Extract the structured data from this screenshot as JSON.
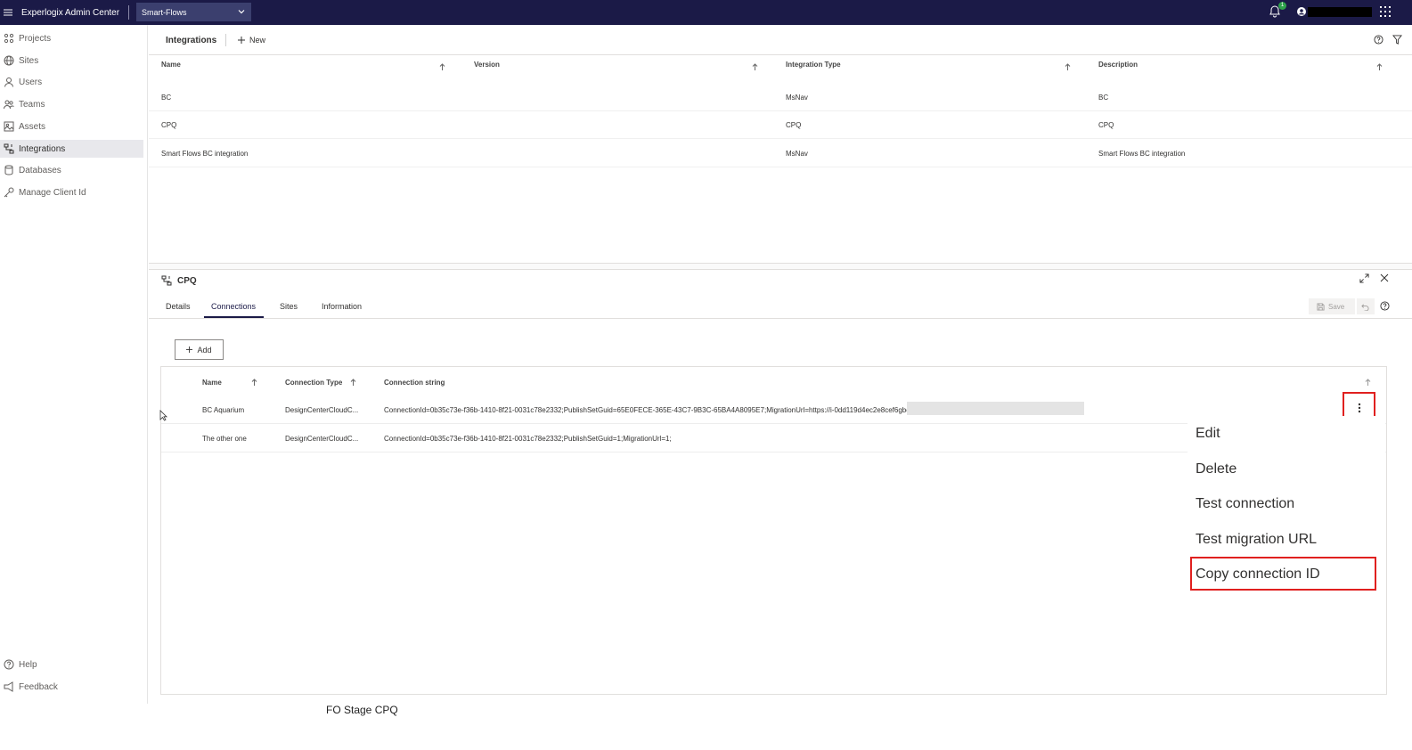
{
  "app": {
    "title": "Experlogix Admin Center",
    "environment": "Smart-Flows",
    "notification_count": "1",
    "user_name": "(redacted)"
  },
  "sidebar": {
    "items": [
      {
        "label": "Projects",
        "icon": "projects-icon"
      },
      {
        "label": "Sites",
        "icon": "globe-icon"
      },
      {
        "label": "Users",
        "icon": "user-icon"
      },
      {
        "label": "Teams",
        "icon": "teams-icon"
      },
      {
        "label": "Assets",
        "icon": "assets-icon"
      },
      {
        "label": "Integrations",
        "icon": "integrations-icon",
        "active": true
      },
      {
        "label": "Databases",
        "icon": "database-icon"
      },
      {
        "label": "Manage Client Id",
        "icon": "key-icon"
      }
    ],
    "bottom": [
      {
        "label": "Help",
        "icon": "help-icon"
      },
      {
        "label": "Feedback",
        "icon": "feedback-icon"
      }
    ]
  },
  "integrations": {
    "title": "Integrations",
    "new_label": "New",
    "columns": [
      "Name",
      "Version",
      "Integration Type",
      "Description"
    ],
    "rows": [
      {
        "name": "BC",
        "version": "",
        "type": "MsNav",
        "description": "BC"
      },
      {
        "name": "CPQ",
        "version": "",
        "type": "CPQ",
        "description": "CPQ"
      },
      {
        "name": "Smart Flows BC integration",
        "version": "",
        "type": "MsNav",
        "description": "Smart Flows BC integration"
      }
    ]
  },
  "detail": {
    "title": "CPQ",
    "tabs": [
      "Details",
      "Connections",
      "Sites",
      "Information"
    ],
    "active_tab": "Connections",
    "save_label": "Save",
    "add_label": "Add",
    "columns": [
      "Name",
      "Connection Type",
      "Connection string"
    ],
    "rows": [
      {
        "name": "BC Aquarium",
        "type": "DesignCenterCloudC...",
        "connection": "ConnectionId=0b35c73e-f36b-1410-8f21-0031c78e2332;PublishSetGuid=65E0FECE-365E-43C7-9B3C-65BA4A8095E7;MigrationUrl=https://i-0dd119d4ec2e8cef6gbc."
      },
      {
        "name": "The other one",
        "type": "DesignCenterCloudC...",
        "connection": "ConnectionId=0b35c73e-f36b-1410-8f21-0031c78e2332;PublishSetGuid=1;MigrationUrl=1;"
      }
    ]
  },
  "context_menu": {
    "items": [
      "Edit",
      "Delete",
      "Test connection",
      "Test migration URL",
      "Copy connection ID"
    ],
    "highlighted": "Copy connection ID"
  },
  "caption": "FO Stage CPQ",
  "colors": {
    "topbar": "#1b1a47",
    "highlight": "#e0201f",
    "active_nav": "#e8e8ec"
  }
}
